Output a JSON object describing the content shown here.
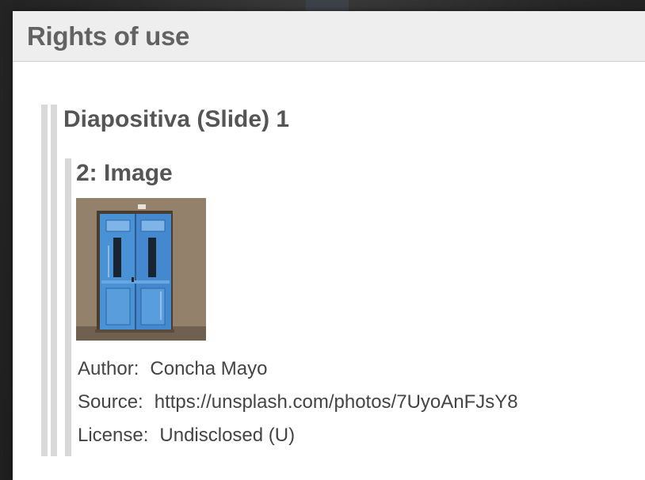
{
  "dialog": {
    "title": "Rights of use"
  },
  "slide": {
    "title": "Diapositiva (Slide) 1",
    "item": {
      "title": "2: Image",
      "image_description": "blue-door-photo",
      "author_label": "Author:",
      "author_value": "Concha Mayo",
      "source_label": "Source:",
      "source_value": "https://unsplash.com/photos/7UyoAnFJsY8",
      "license_label": "License:",
      "license_value": "Undisclosed (U)"
    }
  },
  "colors": {
    "header_bg": "#eeeeee",
    "title_text": "#626262",
    "rule": "#d9d9d9",
    "door_blue": "#4a8fd0"
  }
}
